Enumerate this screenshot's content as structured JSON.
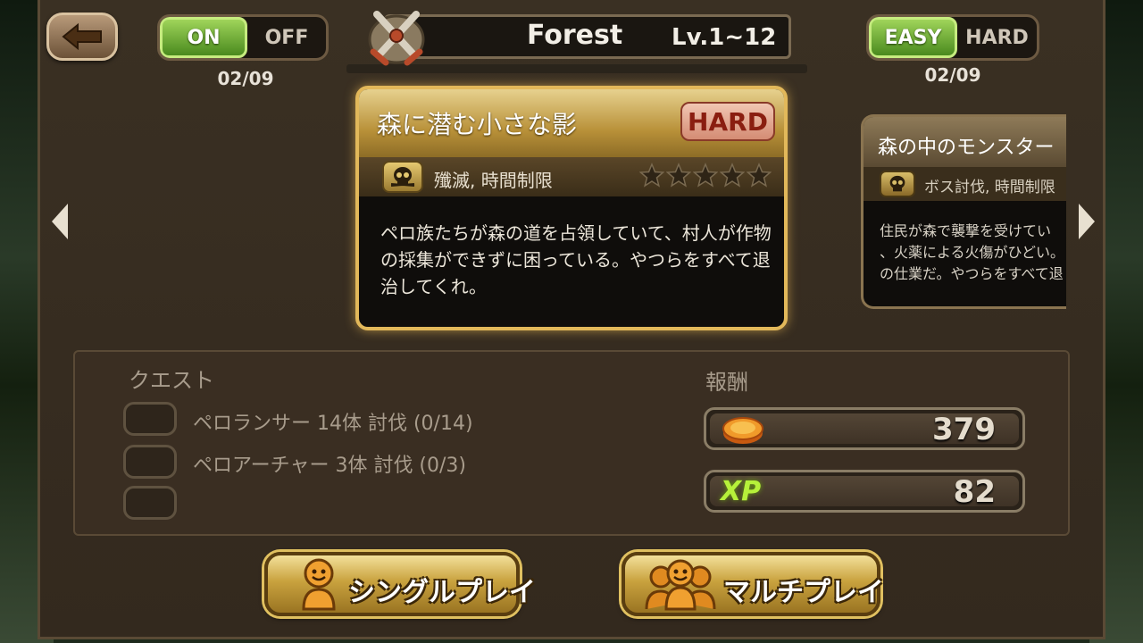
{
  "header": {
    "title": "Forest",
    "level": "Lv.1~12"
  },
  "toggle_auto": {
    "on": "ON",
    "off": "OFF",
    "date": "02/09"
  },
  "toggle_difficulty": {
    "easy": "EASY",
    "hard": "HARD",
    "date": "02/09"
  },
  "quest_card": {
    "title": "森に潜む小さな影",
    "badge": "HARD",
    "type": "殲滅, 時間制限",
    "stars": 5,
    "description": "ペロ族たちが森の道を占領していて、村人が作物の採集ができずに困っている。やつらをすべて退治してくれ。"
  },
  "next_card": {
    "title": "森の中のモンスター",
    "type": "ボス討伐, 時間制限",
    "desc_line1": "住民が森で襲撃を受けてい",
    "desc_line2": "、火薬による火傷がひどい。",
    "desc_line3": "の仕業だ。やつらをすべて退"
  },
  "quest_panel": {
    "label": "クエスト",
    "objectives": [
      "ペロランサー 14体 討伐 (0/14)",
      "ペロアーチャー 3体 討伐 (0/3)"
    ]
  },
  "reward_panel": {
    "label": "報酬",
    "gold": "379",
    "xp_label": "XP",
    "xp": "82"
  },
  "buttons": {
    "single": "シングルプレイ",
    "multi": "マルチプレイ"
  }
}
